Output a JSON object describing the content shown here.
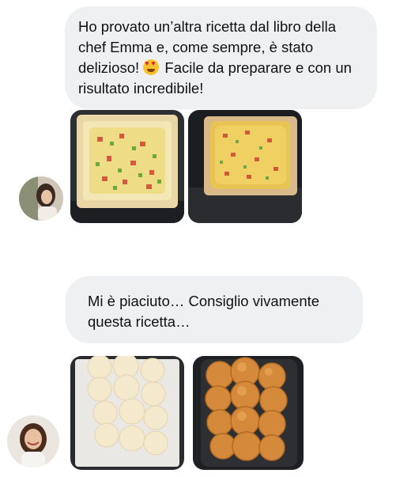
{
  "messages": [
    {
      "text_part1": "Ho provato un’altra ricetta dal libro della chef Emma e, come sempre, è stato delizioso! ",
      "emoji": "smiling-face-with-heart-eyes",
      "text_part2": " Facile da preparare e con un risultato incredibile!",
      "photos": [
        "frittata-raw-in-air-fryer",
        "frittata-cooked-in-air-fryer"
      ]
    },
    {
      "text": "Mi è piaciuto… Consiglio vivamente questa ricetta…",
      "photos": [
        "dough-balls-raw",
        "bread-rolls-baked"
      ]
    }
  ],
  "colors": {
    "bubble": "#eff0f2",
    "text": "#111111",
    "background": "#ffffff"
  }
}
